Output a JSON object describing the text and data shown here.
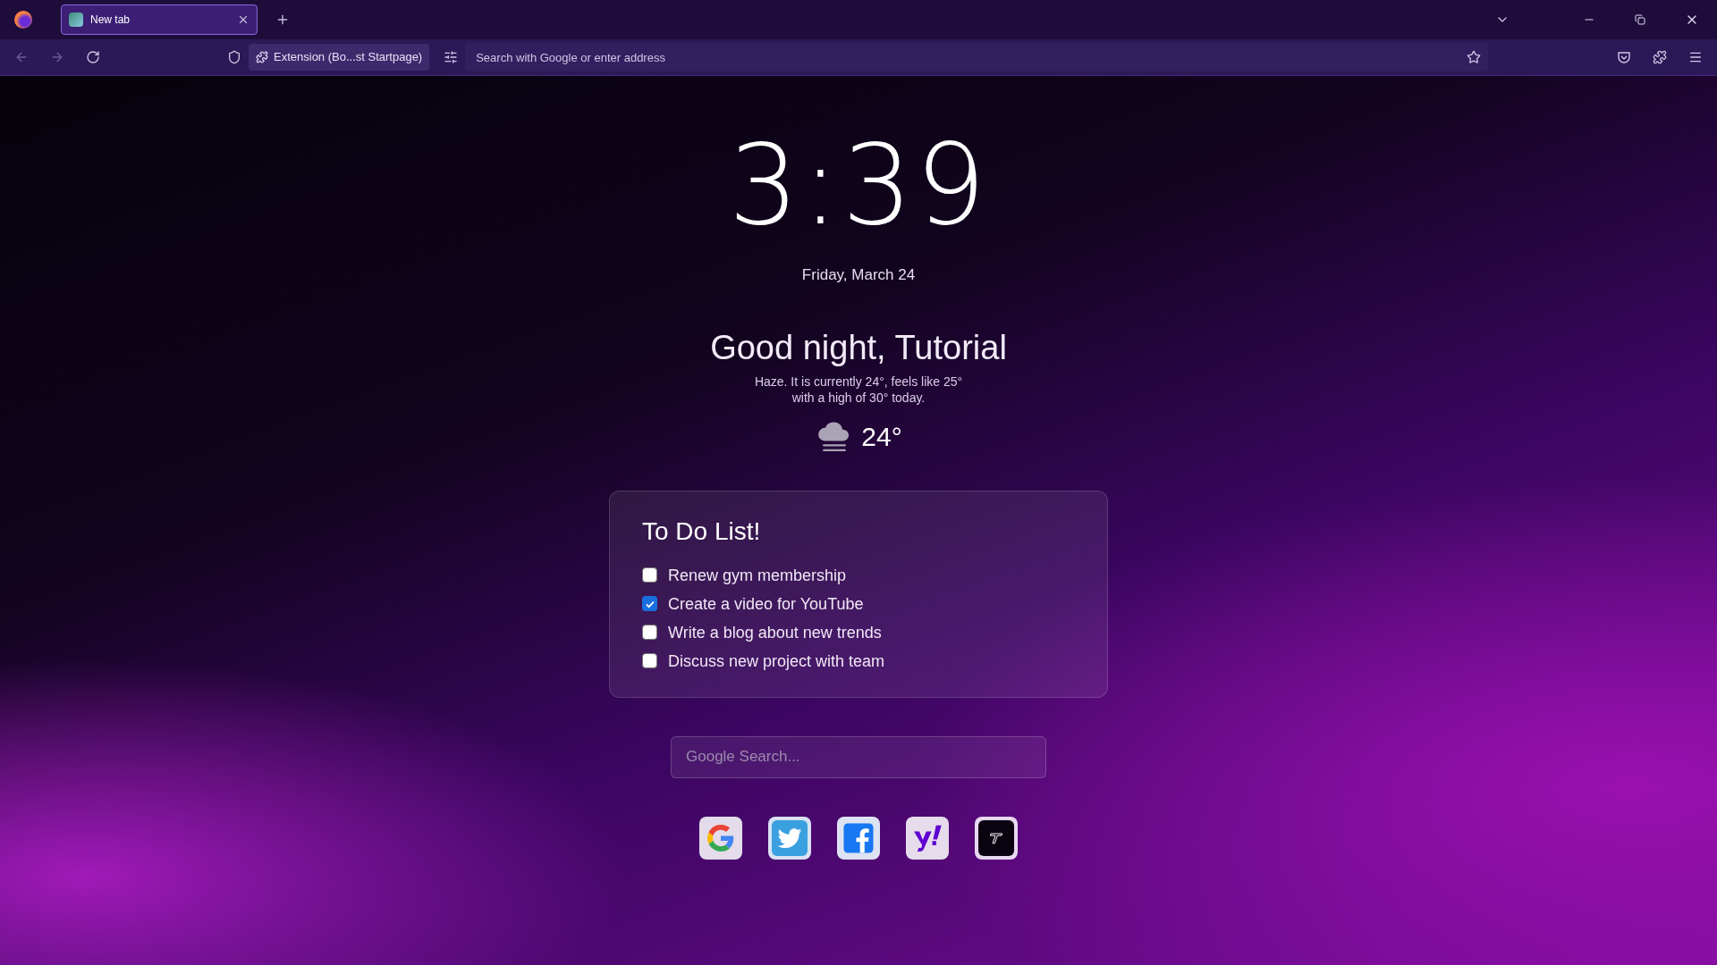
{
  "browser": {
    "tab": {
      "title": "New tab",
      "selected": true
    },
    "address_badge": "Extension (Bo...st Startpage)",
    "address_placeholder": "Search with Google or enter address"
  },
  "clock": "3:39",
  "date": "Friday, March 24",
  "greeting": "Good night, Tutorial",
  "weather": {
    "description_line_1": "Haze. It is currently 24°, feels like 25°",
    "description_line_2": "with a high of 30° today.",
    "temperature": "24°"
  },
  "todo": {
    "title": "To Do List!",
    "items": [
      {
        "label": "Renew gym membership",
        "checked": false
      },
      {
        "label": "Create a video for YouTube",
        "checked": true
      },
      {
        "label": "Write a blog about new trends",
        "checked": false
      },
      {
        "label": "Discuss new project with team",
        "checked": false
      }
    ]
  },
  "search": {
    "placeholder": "Google Search..."
  },
  "shortcuts": [
    {
      "kind": "google"
    },
    {
      "kind": "twitter"
    },
    {
      "kind": "facebook"
    },
    {
      "kind": "yahoo"
    },
    {
      "kind": "tapp"
    }
  ]
}
